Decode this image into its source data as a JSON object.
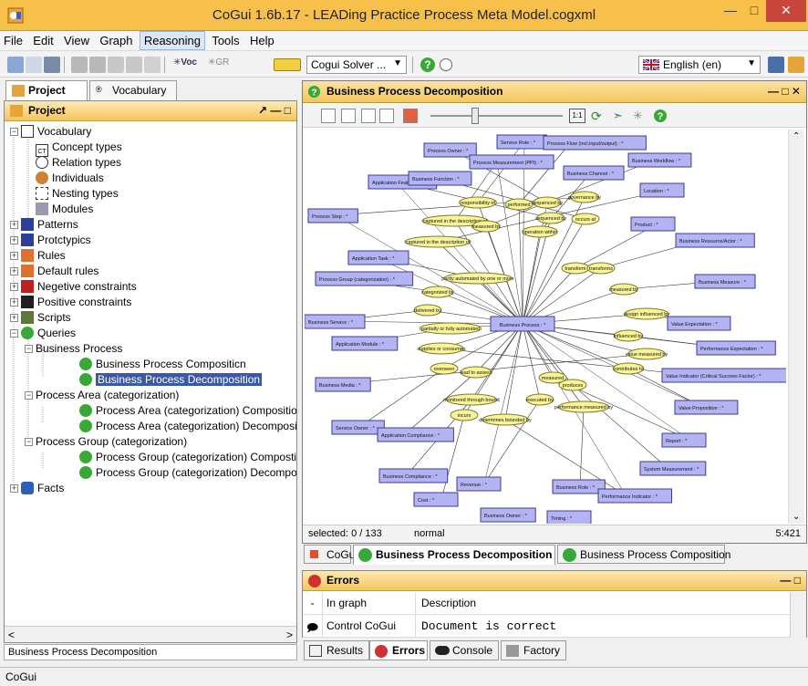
{
  "window": {
    "title": "CoGui 1.6b.17 - LEADing Practice Process Meta Model.cogxml"
  },
  "menu": [
    "File",
    "Edit",
    "View",
    "Graph",
    "Reasoning",
    "Tools",
    "Help"
  ],
  "toolbar": {
    "solver_label": "Cogui Solver ...",
    "language": "English (en)",
    "voc_label": "Voc",
    "gr_label": "GR"
  },
  "left_tabs": [
    "Project",
    "Vocabulary"
  ],
  "project_panel": {
    "title": "Project",
    "tree": {
      "vocabulary": "Vocabulary",
      "concept_types": "Concept types",
      "relation_types": "Relation types",
      "individuals": "Individuals",
      "nesting_types": "Nesting types",
      "modules": "Modules",
      "patterns": "Patterns",
      "prototypics": "Protctypics",
      "rules": "Rules",
      "default_rules": "Default rules",
      "negative_constraints": "Negetive constraints",
      "positive_constraints": "Positive constraints",
      "scripts": "Scripts",
      "queries": "Queries",
      "bp_group": "Business Process",
      "bp_composition": "Business Process Compositicn",
      "bp_decomposition": "Business Process Decomposition",
      "pa_group": "Process Area (categorization)",
      "pa_composition": "Process Area (categorization) Composition",
      "pa_decomposition": "Process Area (categorization) Decompositic",
      "pg_group": "Process Group (categorization)",
      "pg_composition": "Process Group (categorization) Compostion",
      "pg_decomposition": "Process Group (categorization) Decomposit",
      "facts": "Facts"
    },
    "status": "Business Process Decomposition"
  },
  "graph_window": {
    "title": "Business Process Decomposition",
    "zoom_label": "1:1",
    "selected": "selected: 0 / 133",
    "mode": "normal",
    "position": "5:421",
    "center_concept": "Business Process : *",
    "concepts": [
      "Service Role : *",
      "Process Flow (incl.input/output) : *",
      "Process Owner : *",
      "Process Measurement (PPI) : *",
      "Business Workflow : *",
      "Business Channel : *",
      "Application Feature : *",
      "Location : *",
      "Business Function : *",
      "Process Step : *",
      "Product : *",
      "Business Resource/Actor : *",
      "Application Task : *",
      "Process Group (categorization) : *",
      "Business Measure : *",
      "Business Service : *",
      "Value Expectation : *",
      "Application Module : *",
      "Performance Expectation : *",
      "Value Indicator (Critical Success Factor) : *",
      "Business Media : *",
      "Value Proposition : *",
      "Service Owner : *",
      "Application Compliance : *",
      "Report : *",
      "System Measurement : *",
      "Business Compliance : *",
      "Revenue : *",
      "Business Role : *",
      "Cost : *",
      "Performance Indicator : *",
      "Business Owner : *",
      "Timing : *"
    ],
    "relations": [
      "responsibility of",
      "performed",
      "sequenced by",
      "captured in the description of",
      "measured by",
      "operation within",
      "sequenced by",
      "captured in the description of",
      "occurs at",
      "governance by",
      "transform",
      "transforms",
      "partly automated by one or more",
      "categorized by",
      "measured by",
      "delivered by",
      "design influenced by",
      "partially or fully automated",
      "influenced by",
      "supplies or consumes",
      "value measured by",
      "contributes to",
      "overseen",
      "lead to assess",
      "measured",
      "produces",
      "monitored through bound",
      "executed by",
      "performance measured by",
      "incurs",
      "determines bounded by"
    ]
  },
  "doc_tabs": [
    "CoGui",
    "Business Process Decomposition",
    "Business Process Composition"
  ],
  "errors": {
    "title": "Errors",
    "columns": [
      "-",
      "In graph",
      "Description"
    ],
    "rows": [
      {
        "graph": "Control CoGui",
        "description": "Document is correct"
      }
    ]
  },
  "bottom_tabs": [
    "Results",
    "Errors",
    "Console",
    "Factory"
  ],
  "status_bar": "CoGui"
}
